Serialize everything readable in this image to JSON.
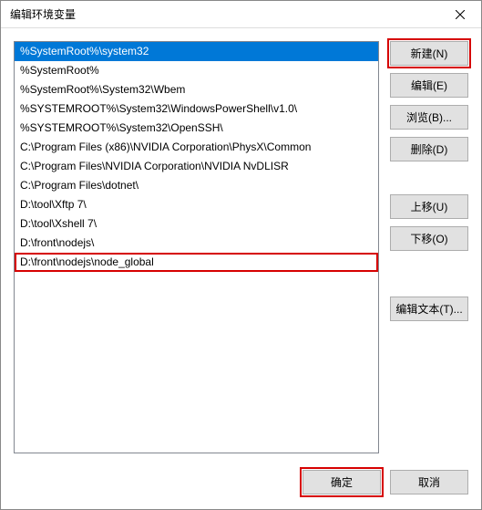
{
  "title": "编辑环境变量",
  "entries": [
    {
      "value": "%SystemRoot%\\system32",
      "selected": true,
      "highlighted": false
    },
    {
      "value": "%SystemRoot%",
      "selected": false,
      "highlighted": false
    },
    {
      "value": "%SystemRoot%\\System32\\Wbem",
      "selected": false,
      "highlighted": false
    },
    {
      "value": "%SYSTEMROOT%\\System32\\WindowsPowerShell\\v1.0\\",
      "selected": false,
      "highlighted": false
    },
    {
      "value": "%SYSTEMROOT%\\System32\\OpenSSH\\",
      "selected": false,
      "highlighted": false
    },
    {
      "value": "C:\\Program Files (x86)\\NVIDIA Corporation\\PhysX\\Common",
      "selected": false,
      "highlighted": false
    },
    {
      "value": "C:\\Program Files\\NVIDIA Corporation\\NVIDIA NvDLISR",
      "selected": false,
      "highlighted": false
    },
    {
      "value": "C:\\Program Files\\dotnet\\",
      "selected": false,
      "highlighted": false
    },
    {
      "value": "D:\\tool\\Xftp 7\\",
      "selected": false,
      "highlighted": false
    },
    {
      "value": "D:\\tool\\Xshell 7\\",
      "selected": false,
      "highlighted": false
    },
    {
      "value": "D:\\front\\nodejs\\",
      "selected": false,
      "highlighted": false
    },
    {
      "value": "D:\\front\\nodejs\\node_global",
      "selected": false,
      "highlighted": true
    }
  ],
  "buttons": {
    "new": "新建(N)",
    "edit": "编辑(E)",
    "browse": "浏览(B)...",
    "delete": "删除(D)",
    "moveup": "上移(U)",
    "movedown": "下移(O)",
    "edittext": "编辑文本(T)...",
    "ok": "确定",
    "cancel": "取消"
  }
}
